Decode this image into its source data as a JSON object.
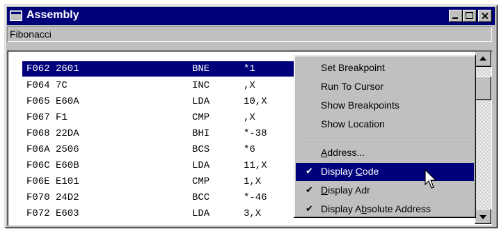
{
  "window": {
    "title": "Assembly",
    "subtitle": "Fibonacci"
  },
  "listing": [
    {
      "addr": "F062 2601",
      "op": "BNE",
      "arg": "*1"
    },
    {
      "addr": "F064 7C",
      "op": "INC",
      "arg": ",X"
    },
    {
      "addr": "F065 E60A",
      "op": "LDA",
      "arg": "10,X"
    },
    {
      "addr": "F067 F1",
      "op": "CMP",
      "arg": ",X"
    },
    {
      "addr": "F068 22DA",
      "op": "BHI",
      "arg": "*-38"
    },
    {
      "addr": "F06A 2506",
      "op": "BCS",
      "arg": "*6"
    },
    {
      "addr": "F06C E60B",
      "op": "LDA",
      "arg": "11,X"
    },
    {
      "addr": "F06E E101",
      "op": "CMP",
      "arg": "1,X"
    },
    {
      "addr": "F070 24D2",
      "op": "BCC",
      "arg": "*-46"
    },
    {
      "addr": "F072 E603",
      "op": "LDA",
      "arg": "3,X"
    }
  ],
  "menu": {
    "set_breakpoint": "Set Breakpoint",
    "run_to_cursor": "Run To Cursor",
    "show_breakpoints": "Show Breakpoints",
    "show_location": "Show Location",
    "address_pre": "",
    "address_u": "A",
    "address_post": "ddress...",
    "display_code_pre": "Display ",
    "display_code_u": "C",
    "display_code_post": "ode",
    "display_adr_pre": "",
    "display_adr_u": "D",
    "display_adr_post": "isplay Adr",
    "display_abs_pre": "Display A",
    "display_abs_u": "b",
    "display_abs_post": "solute Address",
    "check": "✔"
  },
  "colors": {
    "title_bar": "#00007b",
    "selection": "#00007b",
    "face": "#c0c0c0"
  },
  "icons": [
    "window-icon",
    "minimize-icon",
    "maximize-icon",
    "close-icon",
    "scroll-up-icon",
    "scroll-down-icon",
    "check-icon",
    "mouse-pointer-icon"
  ]
}
